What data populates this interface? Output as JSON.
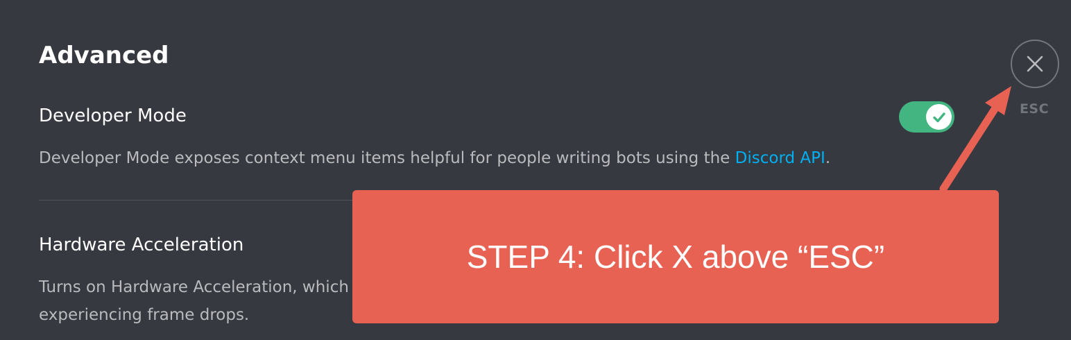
{
  "section": {
    "title": "Advanced"
  },
  "developer_mode": {
    "label": "Developer Mode",
    "description_prefix": "Developer Mode exposes context menu items helpful for people writing bots using the ",
    "link_text": "Discord API",
    "description_suffix": ".",
    "enabled": true
  },
  "hardware_acceleration": {
    "label": "Hardware Acceleration",
    "description_line1": "Turns on Hardware Acceleration, which",
    "description_line2": "experiencing frame drops."
  },
  "close": {
    "icon": "close-icon",
    "esc_label": "ESC"
  },
  "callout": {
    "text": "STEP 4: Click X above “ESC”"
  },
  "colors": {
    "background": "#36393f",
    "toggle_on": "#43b581",
    "link": "#00b0f4",
    "callout": "#e86254"
  }
}
